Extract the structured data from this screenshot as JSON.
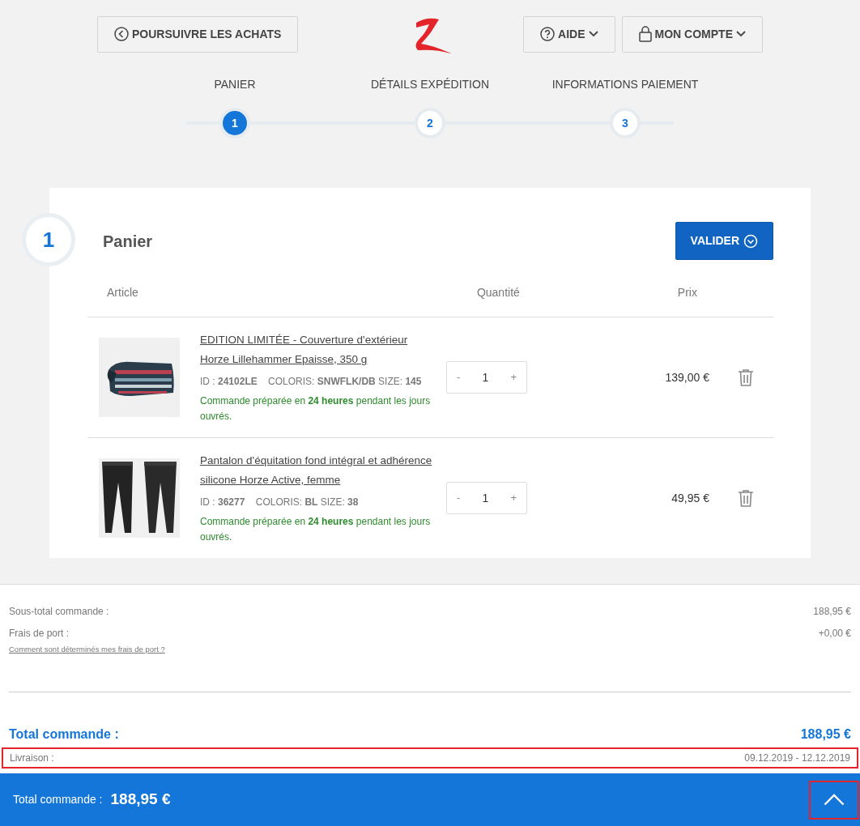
{
  "header": {
    "back_button": "POURSUIVRE LES ACHATS",
    "help_button": "AIDE",
    "account_button": "MON COMPTE"
  },
  "steps": [
    {
      "label": "PANIER",
      "number": "1",
      "selected": true
    },
    {
      "label": "DÉTAILS EXPÉDITION",
      "number": "2",
      "selected": false
    },
    {
      "label": "INFORMATIONS PAIEMENT",
      "number": "3",
      "selected": false
    }
  ],
  "cart": {
    "step_number": "1",
    "title": "Panier",
    "validate_button": "VALIDER",
    "columns": [
      "Article",
      "Quantité",
      "Prix"
    ],
    "items": [
      {
        "kind": "blanket",
        "name": "EDITION LIMITÉE - Couverture d'extérieur Horze Lillehammer Epaisse, 350 g",
        "details": "ID : **24102LE**    COLORIS: **SNWFLK/DB** SIZE: **145**",
        "availability": "Commande préparée en **24 heures** pendant les jours ouvrés.",
        "minus": "-",
        "quantity": "1",
        "plus": "+",
        "price": "139,00 €"
      },
      {
        "kind": "pants",
        "name": "Pantalon d'équitation fond intégral et adhérence silicone Horze Active, femme",
        "details": "ID : **36277**    COLORIS: **BL** SIZE: **38**",
        "availability": "Commande préparée en **24 heures** pendant les jours ouvrés.",
        "minus": "-",
        "quantity": "1",
        "plus": "+",
        "price": "49,95 €"
      }
    ]
  },
  "summary": {
    "subtotal_label": "Sous-total commande :",
    "subtotal": "188,95 €",
    "shipping_label": "Frais de port :",
    "shipping": "+0,00 €",
    "shipping_link": "Comment sont déterminés mes frais de port ?",
    "total_label": "Total commande :",
    "total": "188,95 €",
    "delivery_label": "Livraison :",
    "delivery": "09.12.2019 - 12.12.2019",
    "delivery_highlighted": true
  },
  "bottom_bar": {
    "total_label": "Total commande :",
    "total": "188,95 €",
    "scroll_up_highlighted": true
  }
}
